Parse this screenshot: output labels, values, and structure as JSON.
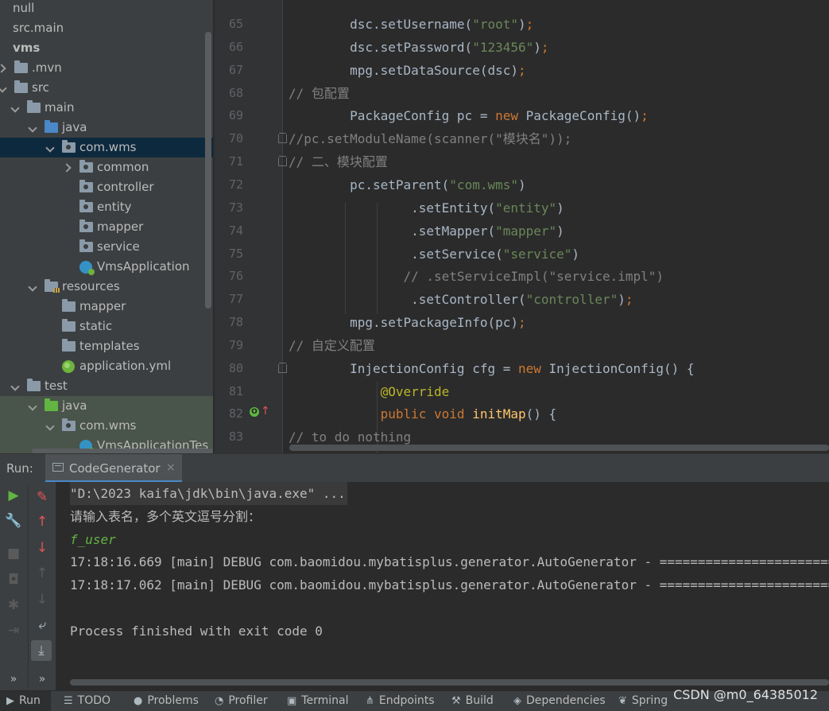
{
  "project_tree": [
    {
      "label": "null",
      "indent": 0,
      "arrow": "none",
      "icon": "none"
    },
    {
      "label": "src.main",
      "indent": 0,
      "arrow": "none",
      "icon": "none"
    },
    {
      "label": "vms",
      "indent": 0,
      "arrow": "none",
      "icon": "none",
      "bold": true
    },
    {
      "label": ".mvn",
      "indent": 1,
      "arrow": "right",
      "icon": "folder"
    },
    {
      "label": "src",
      "indent": 1,
      "arrow": "down",
      "icon": "folder"
    },
    {
      "label": "main",
      "indent": 2,
      "arrow": "down",
      "icon": "folder"
    },
    {
      "label": "java",
      "indent": 3,
      "arrow": "down",
      "icon": "folder-blue"
    },
    {
      "label": "com.wms",
      "indent": 4,
      "arrow": "down",
      "icon": "package",
      "selected": true
    },
    {
      "label": "common",
      "indent": 5,
      "arrow": "right",
      "icon": "package"
    },
    {
      "label": "controller",
      "indent": 5,
      "arrow": "none",
      "icon": "package"
    },
    {
      "label": "entity",
      "indent": 5,
      "arrow": "none",
      "icon": "package"
    },
    {
      "label": "mapper",
      "indent": 5,
      "arrow": "none",
      "icon": "package"
    },
    {
      "label": "service",
      "indent": 5,
      "arrow": "none",
      "icon": "package"
    },
    {
      "label": "VmsApplication",
      "indent": 5,
      "arrow": "none",
      "icon": "spring-app"
    },
    {
      "label": "resources",
      "indent": 3,
      "arrow": "down",
      "icon": "folder-resources"
    },
    {
      "label": "mapper",
      "indent": 4,
      "arrow": "none",
      "icon": "folder"
    },
    {
      "label": "static",
      "indent": 4,
      "arrow": "none",
      "icon": "folder"
    },
    {
      "label": "templates",
      "indent": 4,
      "arrow": "none",
      "icon": "folder"
    },
    {
      "label": "application.yml",
      "indent": 4,
      "arrow": "none",
      "icon": "yml"
    },
    {
      "label": "test",
      "indent": 2,
      "arrow": "down",
      "icon": "folder"
    },
    {
      "label": "java",
      "indent": 3,
      "arrow": "down",
      "icon": "folder-green",
      "test": true
    },
    {
      "label": "com.wms",
      "indent": 4,
      "arrow": "down",
      "icon": "package",
      "test": true
    },
    {
      "label": "VmsApplicationTes",
      "indent": 5,
      "arrow": "none",
      "icon": "spring-app",
      "test": true
    }
  ],
  "editor_lines": [
    {
      "num": "65",
      "tokens": [
        [
          "id",
          "        dsc.setUsername("
        ],
        [
          "str",
          "\"root\""
        ],
        [
          "id",
          ")"
        ],
        [
          "kw",
          ";"
        ]
      ]
    },
    {
      "num": "66",
      "tokens": [
        [
          "id",
          "        dsc.setPassword("
        ],
        [
          "str",
          "\"123456\""
        ],
        [
          "id",
          ")"
        ],
        [
          "kw",
          ";"
        ]
      ]
    },
    {
      "num": "67",
      "tokens": [
        [
          "id",
          "        mpg.setDataSource(dsc)"
        ],
        [
          "kw",
          ";"
        ]
      ]
    },
    {
      "num": "68",
      "tokens": [
        [
          "cmt",
          "// 包配置"
        ]
      ]
    },
    {
      "num": "69",
      "tokens": [
        [
          "id",
          "        PackageConfig pc = "
        ],
        [
          "kw",
          "new "
        ],
        [
          "id",
          "PackageConfig()"
        ],
        [
          "kw",
          ";"
        ]
      ]
    },
    {
      "num": "70",
      "fold": true,
      "tokens": [
        [
          "cmt",
          "//pc.setModuleName(scanner(\"模块名\"));"
        ]
      ]
    },
    {
      "num": "71",
      "fold": true,
      "tokens": [
        [
          "cmt",
          "// 二、模块配置"
        ]
      ]
    },
    {
      "num": "72",
      "tokens": [
        [
          "id",
          "        pc.setParent("
        ],
        [
          "str",
          "\"com.wms\""
        ],
        [
          "id",
          ")"
        ]
      ]
    },
    {
      "num": "73",
      "tokens": [
        [
          "id",
          "                .setEntity("
        ],
        [
          "str",
          "\"entity\""
        ],
        [
          "id",
          ")"
        ]
      ]
    },
    {
      "num": "74",
      "tokens": [
        [
          "id",
          "                .setMapper("
        ],
        [
          "str",
          "\"mapper\""
        ],
        [
          "id",
          ")"
        ]
      ]
    },
    {
      "num": "75",
      "tokens": [
        [
          "id",
          "                .setService("
        ],
        [
          "str",
          "\"service\""
        ],
        [
          "id",
          ")"
        ]
      ]
    },
    {
      "num": "76",
      "tokens": [
        [
          "cmt",
          "               // .setServiceImpl(\"service.impl\")"
        ]
      ]
    },
    {
      "num": "77",
      "tokens": [
        [
          "id",
          "                .setController("
        ],
        [
          "str",
          "\"controller\""
        ],
        [
          "id",
          ")"
        ],
        [
          "kw",
          ";"
        ]
      ]
    },
    {
      "num": "78",
      "tokens": [
        [
          "id",
          "        mpg.setPackageInfo(pc)"
        ],
        [
          "kw",
          ";"
        ]
      ]
    },
    {
      "num": "79",
      "tokens": [
        [
          "cmt",
          "// 自定义配置"
        ]
      ]
    },
    {
      "num": "80",
      "fold": true,
      "tokens": [
        [
          "id",
          "        InjectionConfig cfg = "
        ],
        [
          "kw",
          "new "
        ],
        [
          "id",
          "InjectionConfig() {"
        ]
      ]
    },
    {
      "num": "81",
      "tokens": [
        [
          "ann",
          "            @Override"
        ]
      ]
    },
    {
      "num": "82",
      "override": true,
      "tokens": [
        [
          "kw",
          "            public void "
        ],
        [
          "fn",
          "initMap"
        ],
        [
          "id",
          "() {"
        ]
      ]
    },
    {
      "num": "83",
      "tokens": [
        [
          "cmt",
          "// to do nothing"
        ]
      ]
    }
  ],
  "run_panel": {
    "title": "Run:",
    "tab_label": "CodeGenerator",
    "tab_close": "×",
    "console": [
      {
        "text": "\"D:\\2023 kaifa\\jdk\\bin\\java.exe\" ...",
        "kind": "cmd"
      },
      {
        "text": "请输入表名，多个英文逗号分割：",
        "kind": "out"
      },
      {
        "text": "f_user",
        "kind": "input"
      },
      {
        "text": "17:18:16.669 [main] DEBUG com.baomidou.mybatisplus.generator.AutoGenerator - ==================================",
        "kind": "out"
      },
      {
        "text": "17:18:17.062 [main] DEBUG com.baomidou.mybatisplus.generator.AutoGenerator - ==================================",
        "kind": "out"
      },
      {
        "text": "",
        "kind": "out"
      },
      {
        "text": "Process finished with exit code 0",
        "kind": "out"
      }
    ],
    "toolbar_icons": [
      "play-icon",
      "stop-console-icon",
      "wrench-icon",
      "up-arrow-icon",
      "down-arrow-icon",
      "stop-icon",
      "camera-icon",
      "scroll-up-icon",
      "settings-icon",
      "scroll-down-icon",
      "exit-icon",
      "soft-wrap-icon",
      "scroll-to-end-icon",
      "more-icon"
    ]
  },
  "bottom_bar": [
    {
      "label": "Run",
      "icon": "▶",
      "active": true
    },
    {
      "label": "TODO",
      "icon": "☰"
    },
    {
      "label": "Problems",
      "icon": "●"
    },
    {
      "label": "Profiler",
      "icon": "◔"
    },
    {
      "label": "Terminal",
      "icon": "▣"
    },
    {
      "label": "Endpoints",
      "icon": "⋔"
    },
    {
      "label": "Build",
      "icon": "⚒"
    },
    {
      "label": "Dependencies",
      "icon": "◈"
    },
    {
      "label": "Spring",
      "icon": "❦"
    }
  ],
  "watermark": "CSDN @m0_64385012"
}
